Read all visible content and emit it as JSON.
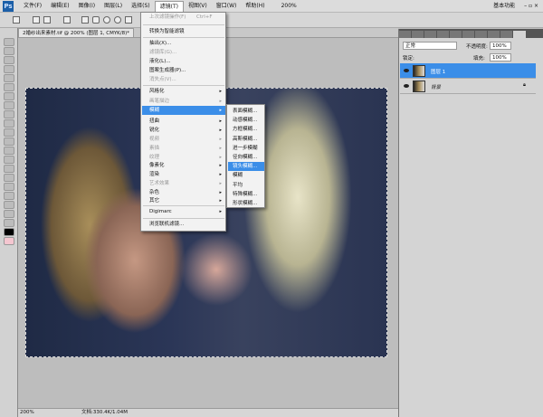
{
  "app": {
    "logo": "Ps"
  },
  "menubar": [
    "文件(F)",
    "编辑(E)",
    "图像(I)",
    "图层(L)",
    "选择(S)",
    "滤镜(T)",
    "视图(V)",
    "窗口(W)",
    "帮助(H)"
  ],
  "appbar": {
    "zoom": "200%",
    "workspace": "基本功能"
  },
  "document": {
    "tab": "2婚纱出来素材.tif @ 200% (图层 1, CMYK/8)*"
  },
  "status": {
    "zoom": "200%",
    "doc": "文档:330.4K/1.04M"
  },
  "layers_panel": {
    "blend": "正常",
    "opacity_label": "不透明度:",
    "opacity": "100%",
    "lock_label": "锁定:",
    "fill_label": "填充:",
    "fill": "100%",
    "layers": [
      {
        "name": "图层 1",
        "selected": true
      },
      {
        "name": "背景",
        "locked": true
      }
    ]
  },
  "filter_menu": {
    "items": [
      {
        "label": "上次滤镜操作(F)",
        "shortcut": "Ctrl+F",
        "disabled": true
      },
      {
        "label": "转换为智能滤镜"
      },
      {
        "label": "抽出(X)..."
      },
      {
        "label": "滤镜库(G)...",
        "disabled": true
      },
      {
        "label": "液化(L)..."
      },
      {
        "label": "图案生成器(P)..."
      },
      {
        "label": "消失点(V)...",
        "disabled": true
      },
      {
        "label": "风格化",
        "sub": true
      },
      {
        "label": "画笔描边",
        "sub": true,
        "disabled": true
      },
      {
        "label": "模糊",
        "sub": true,
        "highlighted": true
      },
      {
        "label": "扭曲",
        "sub": true
      },
      {
        "label": "锐化",
        "sub": true
      },
      {
        "label": "视频",
        "sub": true,
        "disabled": true
      },
      {
        "label": "素描",
        "sub": true,
        "disabled": true
      },
      {
        "label": "纹理",
        "sub": true,
        "disabled": true
      },
      {
        "label": "像素化",
        "sub": true
      },
      {
        "label": "渲染",
        "sub": true
      },
      {
        "label": "艺术效果",
        "sub": true,
        "disabled": true
      },
      {
        "label": "杂色",
        "sub": true
      },
      {
        "label": "其它",
        "sub": true
      },
      {
        "label": "Digimarc",
        "sub": true
      },
      {
        "label": "浏览联机滤镜..."
      }
    ]
  },
  "blur_submenu": [
    "表面模糊...",
    "动感模糊...",
    "方框模糊...",
    "高斯模糊...",
    "进一步模糊",
    "径向模糊...",
    "镜头模糊...",
    "模糊",
    "平均",
    "特殊模糊...",
    "形状模糊..."
  ]
}
